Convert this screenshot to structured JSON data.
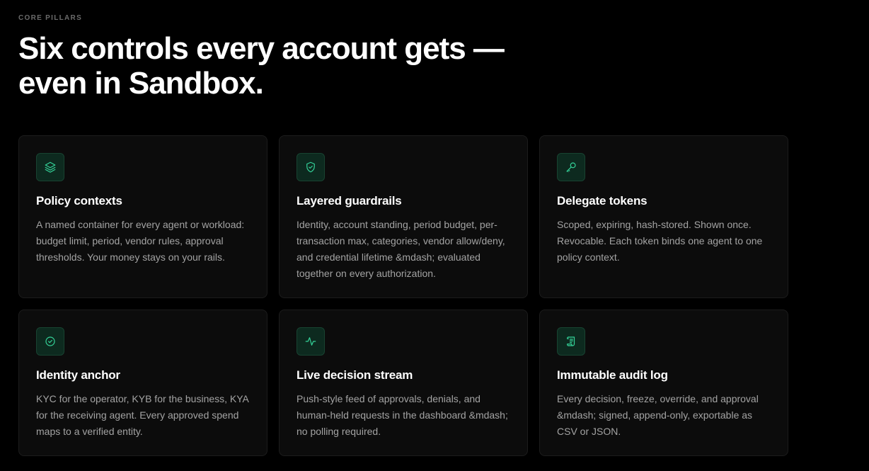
{
  "section": {
    "eyebrow": "CORE PILLARS",
    "headline": "Six controls every account gets — even in Sandbox."
  },
  "accent_color": "#34d399",
  "cards": [
    {
      "icon": "layers-icon",
      "title": "Policy contexts",
      "description": "A named container for every agent or workload: budget limit, period, vendor rules, approval thresholds. Your money stays on your rails."
    },
    {
      "icon": "shield-check-icon",
      "title": "Layered guardrails",
      "description": "Identity, account standing, period budget, per-transaction max, categories, vendor allow/deny, and credential lifetime &mdash; evaluated together on every authorization."
    },
    {
      "icon": "key-icon",
      "title": "Delegate tokens",
      "description": "Scoped, expiring, hash-stored. Shown once. Revocable. Each token binds one agent to one policy context."
    },
    {
      "icon": "badge-check-icon",
      "title": "Identity anchor",
      "description": "KYC for the operator, KYB for the business, KYA for the receiving agent. Every approved spend maps to a verified entity."
    },
    {
      "icon": "activity-icon",
      "title": "Live decision stream",
      "description": "Push-style feed of approvals, denials, and human-held requests in the dashboard &mdash; no polling required."
    },
    {
      "icon": "scroll-icon",
      "title": "Immutable audit log",
      "description": "Every decision, freeze, override, and approval &mdash; signed, append-only, exportable as CSV or JSON."
    }
  ]
}
